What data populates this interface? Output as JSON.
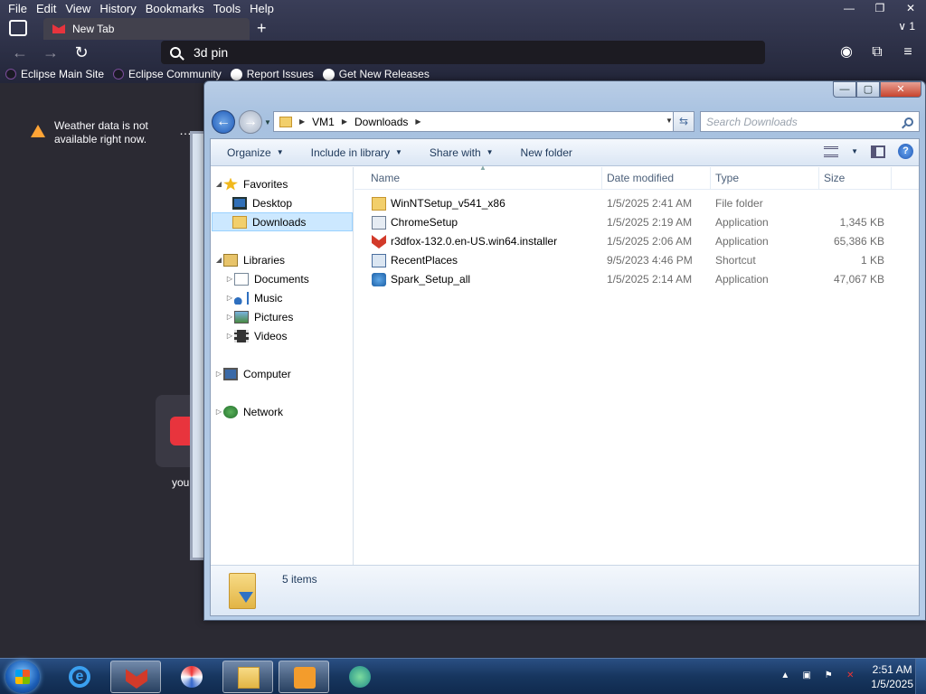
{
  "browser": {
    "menu": [
      "File",
      "Edit",
      "View",
      "History",
      "Bookmarks",
      "Tools",
      "Help"
    ],
    "window_controls": {
      "minimize": "—",
      "restore": "❐",
      "close": "✕"
    },
    "tab": {
      "title": "New Tab",
      "close": "✕"
    },
    "new_tab": "+",
    "tab_count": "∨ 1",
    "url": "3d pin",
    "nav": {
      "back": "←",
      "forward": "→",
      "reload": "↻"
    },
    "nav_right": {
      "account": "◉",
      "extensions": "⧉",
      "menu": "≡"
    },
    "bookmarks": [
      {
        "label": "Eclipse Main Site",
        "icon": "eclipse-icon"
      },
      {
        "label": "Eclipse Community",
        "icon": "eclipse-icon"
      },
      {
        "label": "Report Issues",
        "icon": "github-icon"
      },
      {
        "label": "Get New Releases",
        "icon": "github-icon"
      }
    ]
  },
  "newtab": {
    "weather": "Weather data is not available right now.",
    "weather_menu": "…",
    "shortcut_label": "you"
  },
  "explorer": {
    "caption": {
      "minimize": "—",
      "maximize": "▢",
      "close": "✕"
    },
    "address": {
      "crumbs": [
        "VM1",
        "Downloads"
      ]
    },
    "search_placeholder": "Search Downloads",
    "toolbar": {
      "organize": "Organize",
      "include": "Include in library",
      "share": "Share with",
      "new_folder": "New folder"
    },
    "nav": {
      "favorites": "Favorites",
      "desktop": "Desktop",
      "downloads": "Downloads",
      "libraries": "Libraries",
      "documents": "Documents",
      "music": "Music",
      "pictures": "Pictures",
      "videos": "Videos",
      "computer": "Computer",
      "network": "Network"
    },
    "columns": {
      "name": "Name",
      "date": "Date modified",
      "type": "Type",
      "size": "Size"
    },
    "files": [
      {
        "name": "WinNTSetup_v541_x86",
        "date": "1/5/2025 2:41 AM",
        "type": "File folder",
        "size": "",
        "icon": "folder-icon"
      },
      {
        "name": "ChromeSetup",
        "date": "1/5/2025 2:19 AM",
        "type": "Application",
        "size": "1,345 KB",
        "icon": "setup-icon"
      },
      {
        "name": "r3dfox-132.0.en-US.win64.installer",
        "date": "1/5/2025 2:06 AM",
        "type": "Application",
        "size": "65,386 KB",
        "icon": "fox-icon"
      },
      {
        "name": "RecentPlaces",
        "date": "9/5/2023 4:46 PM",
        "type": "Shortcut",
        "size": "1 KB",
        "icon": "shortcut-icon"
      },
      {
        "name": "Spark_Setup_all",
        "date": "1/5/2025 2:14 AM",
        "type": "Application",
        "size": "47,067 KB",
        "icon": "spark-icon"
      }
    ],
    "item_count": "5 items"
  },
  "taskbar": {
    "clock_time": "2:51 AM",
    "clock_date": "1/5/2025",
    "tray_up": "▲"
  }
}
